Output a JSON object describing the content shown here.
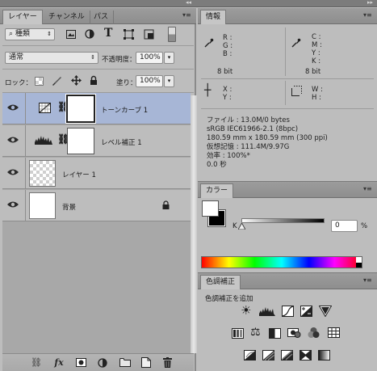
{
  "layers_panel": {
    "tabs": [
      "レイヤー",
      "チャンネル",
      "パス"
    ],
    "filter_kind": "種類",
    "blend_mode": "通常",
    "opacity_label": "不透明度：",
    "opacity_value": "100%",
    "lock_label": "ロック：",
    "fill_label": "塗り：",
    "fill_value": "100%",
    "layers": [
      {
        "name": "トーンカーブ 1",
        "type": "adjustment-curves",
        "selected": true
      },
      {
        "name": "レベル補正 1",
        "type": "adjustment-levels",
        "selected": false
      },
      {
        "name": "レイヤー 1",
        "type": "transparent",
        "selected": false
      },
      {
        "name": "背景",
        "type": "background",
        "selected": false
      }
    ],
    "footer_fx": "fx"
  },
  "info_panel": {
    "tab": "情報",
    "rgb_labels": [
      "R :",
      "G :",
      "B :"
    ],
    "cmyk_labels": [
      "C :",
      "M :",
      "Y :",
      "K :"
    ],
    "bit_left": "8 bit",
    "bit_right": "8 bit",
    "xy_labels": [
      "X :",
      "Y :"
    ],
    "wh_labels": [
      "W :",
      "H :"
    ],
    "lines": [
      "ファイル : 13.0M/0 bytes",
      "sRGB IEC61966-2.1 (8bpc)",
      "180.59 mm x 180.59 mm (300 ppi)",
      "仮想記憶 : 111.4M/9.97G",
      "効率 : 100%*",
      "0.0 秒"
    ]
  },
  "color_panel": {
    "tab": "カラー",
    "slider_label": "K",
    "value": "0",
    "unit": "%"
  },
  "adjustments_panel": {
    "tab": "色調補正",
    "heading": "色調補正を追加"
  },
  "colors": {
    "selected_row": "#a7b6d6",
    "panel_bg": "#bdbdbd"
  }
}
